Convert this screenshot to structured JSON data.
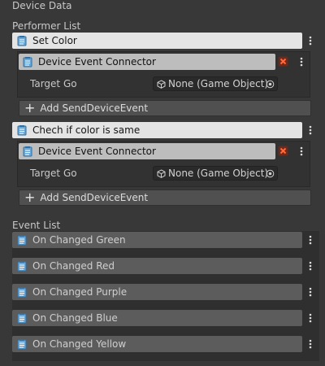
{
  "header": {
    "title": "Device Data"
  },
  "performer": {
    "label": "Performer List",
    "items": [
      {
        "name": "Set Color",
        "connector": "Device Event Connector",
        "target_label": "Target Go",
        "target_value": "None (Game Object)",
        "add_label": "Add SendDeviceEvent"
      },
      {
        "name": "Chech if color is same",
        "connector": "Device Event Connector",
        "target_label": "Target Go",
        "target_value": "None (Game Object)",
        "add_label": "Add SendDeviceEvent"
      }
    ]
  },
  "events": {
    "label": "Event List",
    "items": [
      "On Changed Green",
      "On Changed Red",
      "On Changed Purple",
      "On Changed Blue",
      "On Changed Yellow"
    ]
  },
  "colors": {
    "remove_icon": "#d9482b",
    "script_icon": "#4a90c8"
  }
}
